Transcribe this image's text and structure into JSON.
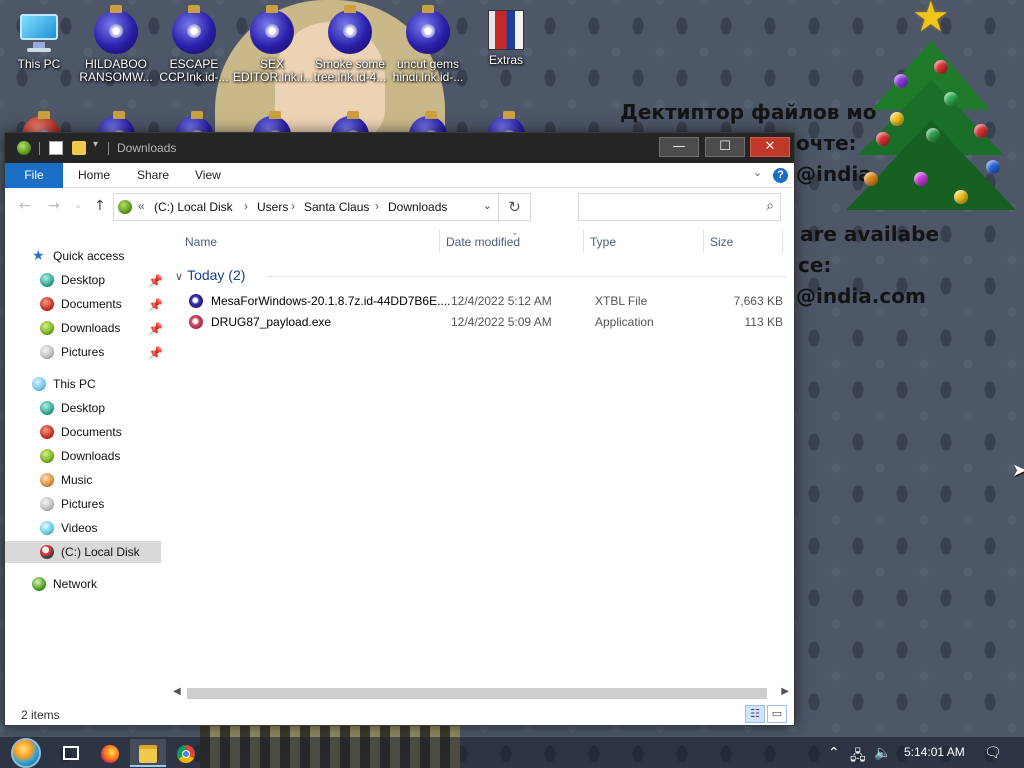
{
  "desktop": {
    "icons": [
      {
        "label": "This PC",
        "icon": "this-pc-icon"
      },
      {
        "label": "HILDABOO RANSOMW...",
        "icon": "ornament-icon"
      },
      {
        "label": "ESCAPE CCP.lnk.id-...",
        "icon": "ornament-icon"
      },
      {
        "label": "SEX EDITOR.lnk.i...",
        "icon": "ornament-icon"
      },
      {
        "label": "Smoke some tree.lnk.id-4...",
        "icon": "ornament-icon"
      },
      {
        "label": "uncut gems hindi.lnk.id-...",
        "icon": "ornament-icon"
      },
      {
        "label": "Extras",
        "icon": "extras-icon"
      }
    ],
    "ransom_note": [
      "Дектиптор файлов мо",
      "очте:",
      "@india.",
      "are availabe",
      "ce:",
      "@india.com"
    ]
  },
  "window": {
    "title": "Downloads",
    "controls": {
      "minimize": "—",
      "maximize": "☐",
      "close": "✕"
    },
    "ribbon": {
      "tabs": [
        "File",
        "Home",
        "Share",
        "View"
      ]
    },
    "address": {
      "prefix": "«",
      "segments": [
        "(C:) Local Disk",
        "Users",
        "Santa Claus",
        "Downloads"
      ],
      "refresh": "↻"
    },
    "search": {
      "value": "",
      "placeholder": ""
    },
    "sidebar": {
      "items": [
        {
          "label": "Quick access",
          "icon": "star-icon",
          "pinned": false
        },
        {
          "label": "Desktop",
          "icon": "desktop-icon",
          "pinned": true
        },
        {
          "label": "Documents",
          "icon": "documents-icon",
          "pinned": true
        },
        {
          "label": "Downloads",
          "icon": "downloads-icon",
          "pinned": true
        },
        {
          "label": "Pictures",
          "icon": "pictures-icon",
          "pinned": true
        },
        {
          "label": "This PC",
          "icon": "this-pc-icon",
          "pinned": false
        },
        {
          "label": "Desktop",
          "icon": "desktop-icon",
          "pinned": false
        },
        {
          "label": "Documents",
          "icon": "documents-icon",
          "pinned": false
        },
        {
          "label": "Downloads",
          "icon": "downloads-icon",
          "pinned": false
        },
        {
          "label": "Music",
          "icon": "music-icon",
          "pinned": false
        },
        {
          "label": "Pictures",
          "icon": "pictures-icon",
          "pinned": false
        },
        {
          "label": "Videos",
          "icon": "videos-icon",
          "pinned": false
        },
        {
          "label": "(C:) Local Disk",
          "icon": "local-disk-icon",
          "pinned": false
        },
        {
          "label": "Network",
          "icon": "network-icon",
          "pinned": false
        }
      ]
    },
    "columns": [
      "Name",
      "Date modified",
      "Type",
      "Size"
    ],
    "group": "Today (2)",
    "files": [
      {
        "name": "MesaForWindows-20.1.8.7z.id-44DD7B6E....",
        "date": "12/4/2022 5:12 AM",
        "type": "XTBL File",
        "size": "7,663 KB",
        "icon": "xtbl-file-icon"
      },
      {
        "name": "DRUG87_payload.exe",
        "date": "12/4/2022 5:09 AM",
        "type": "Application",
        "size": "113 KB",
        "icon": "application-icon"
      }
    ],
    "status": {
      "item_count": "2 items"
    }
  },
  "taskbar": {
    "apps": [
      "task-view-icon",
      "firefox-icon",
      "file-explorer-icon",
      "chrome-icon"
    ],
    "active_app": "file-explorer-icon",
    "clock": "5:14:01 AM"
  },
  "colors": {
    "accent": "#1a6fc4",
    "titlebar": "#252525",
    "close_button": "#c0392b",
    "selected_nav": "#d9d9d9",
    "group_header": "#1e3f8a"
  }
}
